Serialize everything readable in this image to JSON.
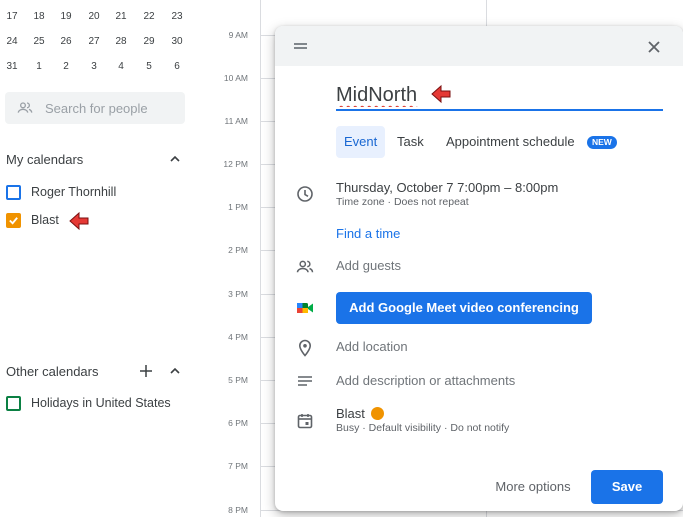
{
  "mini_calendar": {
    "weeks": [
      [
        "17",
        "18",
        "19",
        "20",
        "21",
        "22",
        "23"
      ],
      [
        "24",
        "25",
        "26",
        "27",
        "28",
        "29",
        "30"
      ],
      [
        "31",
        "1",
        "2",
        "3",
        "4",
        "5",
        "6"
      ]
    ]
  },
  "sidebar": {
    "search_placeholder": "Search for people",
    "my_calendars_title": "My calendars",
    "my_calendars": [
      {
        "label": "Roger Thornhill",
        "checked": false,
        "color": "#1a73e8"
      },
      {
        "label": "Blast",
        "checked": true,
        "color": "#f09300"
      }
    ],
    "other_calendars_title": "Other calendars",
    "other_calendars": [
      {
        "label": "Holidays in United States",
        "checked": false,
        "color": "#0b8043"
      }
    ]
  },
  "time_grid": {
    "hours": [
      "9 AM",
      "10 AM",
      "11 AM",
      "12 PM",
      "1 PM",
      "2 PM",
      "3 PM",
      "4 PM",
      "5 PM",
      "6 PM",
      "7 PM",
      "8 PM"
    ]
  },
  "dialog": {
    "title_value": "MidNorth",
    "tabs": {
      "event": "Event",
      "task": "Task",
      "appointment": "Appointment schedule"
    },
    "new_badge": "NEW",
    "date_time": "Thursday, October 7    7:00pm  –  8:00pm",
    "time_subtext": "Time zone · Does not repeat",
    "find_time": "Find a time",
    "add_guests": "Add guests",
    "meet_button": "Add Google Meet video conferencing",
    "add_location": "Add location",
    "add_description": "Add description or attachments",
    "calendar_name": "Blast",
    "calendar_color": "#f09300",
    "calendar_subtext": "Busy · Default visibility · Do not notify",
    "more_options": "More options",
    "save": "Save"
  },
  "colors": {
    "accent": "#1a73e8",
    "annotation_arrow": "#e53935"
  }
}
